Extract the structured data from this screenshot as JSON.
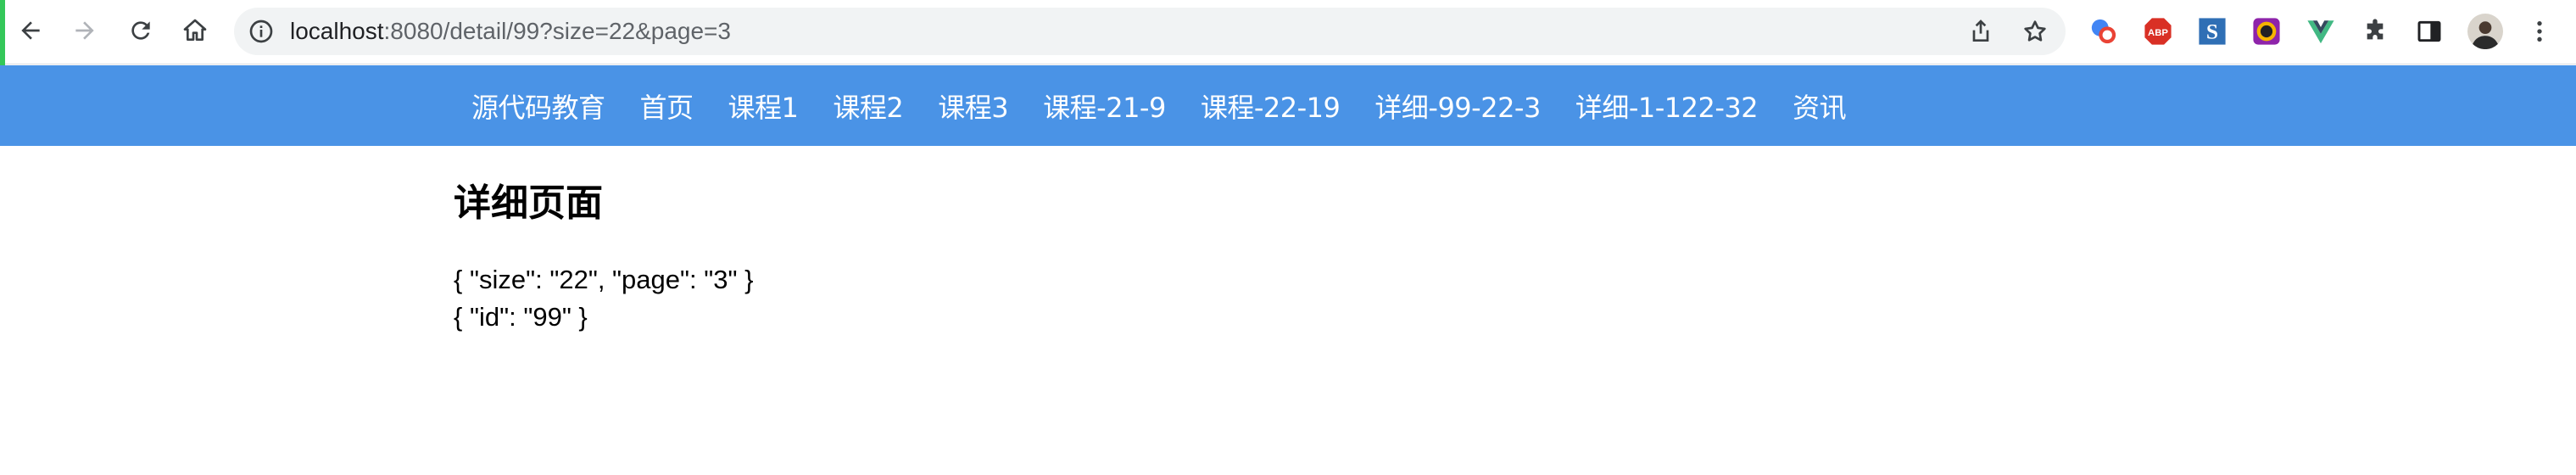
{
  "browser": {
    "url_host": "localhost",
    "url_rest": ":8080/detail/99?size=22&page=3",
    "nav_icons": [
      "back-icon",
      "forward-icon",
      "reload-icon",
      "home-icon"
    ],
    "omnibox_icons": [
      "site-info-icon",
      "share-icon",
      "bookmark-star-icon"
    ],
    "extensions": [
      {
        "name": "translate-extension-icon",
        "color": "#1a73e8"
      },
      {
        "name": "adblock-plus-extension-icon",
        "color": "#d93025",
        "label": "ABP"
      },
      {
        "name": "s-extension-icon",
        "color": "#2f6fb5"
      },
      {
        "name": "color-picker-extension-icon",
        "color": "#8e24aa"
      },
      {
        "name": "vue-devtools-extension-icon",
        "color": "#41b883"
      },
      {
        "name": "extensions-puzzle-icon",
        "color": "#5f6368"
      },
      {
        "name": "side-panel-icon",
        "color": "#202124"
      },
      {
        "name": "profile-avatar",
        "color": "#3c3c3c"
      },
      {
        "name": "more-menu-icon",
        "color": "#5f6368"
      }
    ]
  },
  "navbar": {
    "background": "#4a93e6",
    "links": [
      "源代码教育",
      "首页",
      "课程1",
      "课程2",
      "课程3",
      "课程-21-9",
      "课程-22-19",
      "详细-99-22-3",
      "详细-1-122-32",
      "资讯"
    ]
  },
  "page": {
    "title": "详细页面",
    "query_json": "{ \"size\": \"22\", \"page\": \"3\" }",
    "params_json": "{ \"id\": \"99\" }"
  }
}
